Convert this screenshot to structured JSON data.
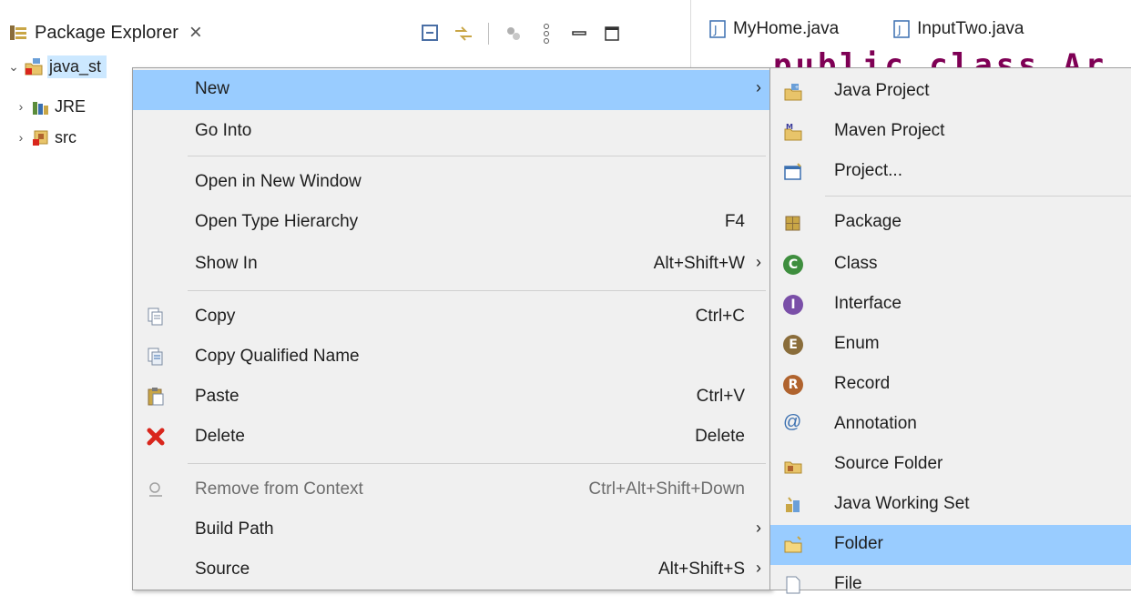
{
  "package_explorer": {
    "title": "Package Explorer",
    "tree": {
      "root": "java_st",
      "children": [
        "JRE",
        "src"
      ]
    }
  },
  "editor": {
    "tabs": [
      "MyHome.java",
      "InputTwo.java"
    ],
    "code_peek": "public class Ar"
  },
  "context_menu": {
    "items": [
      {
        "label": "New",
        "accel": "",
        "submenu": true,
        "highlighted": true,
        "icon": ""
      },
      {
        "label": "Go Into",
        "accel": "",
        "submenu": false,
        "icon": ""
      },
      {
        "label": "Open in New Window",
        "accel": "",
        "submenu": false,
        "icon": ""
      },
      {
        "label": "Open Type Hierarchy",
        "accel": "F4",
        "submenu": false,
        "icon": ""
      },
      {
        "label": "Show In",
        "accel": "Alt+Shift+W",
        "submenu": true,
        "icon": ""
      },
      {
        "label": "Copy",
        "accel": "Ctrl+C",
        "submenu": false,
        "icon": "copy-icon"
      },
      {
        "label": "Copy Qualified Name",
        "accel": "",
        "submenu": false,
        "icon": "copy-qualified-name-icon"
      },
      {
        "label": "Paste",
        "accel": "Ctrl+V",
        "submenu": false,
        "icon": "paste-icon"
      },
      {
        "label": "Delete",
        "accel": "Delete",
        "submenu": false,
        "icon": "delete-icon"
      },
      {
        "label": "Remove from Context",
        "accel": "Ctrl+Alt+Shift+Down",
        "submenu": false,
        "disabled": true,
        "icon": "remove-from-context-icon"
      },
      {
        "label": "Build Path",
        "accel": "",
        "submenu": true,
        "icon": ""
      },
      {
        "label": "Source",
        "accel": "Alt+Shift+S",
        "submenu": true,
        "icon": ""
      }
    ]
  },
  "submenu_new": {
    "items": [
      {
        "label": "Java Project",
        "icon": "java-project-icon"
      },
      {
        "label": "Maven Project",
        "icon": "maven-project-icon"
      },
      {
        "label": "Project...",
        "icon": "project-icon"
      },
      {
        "label": "Package",
        "icon": "package-icon"
      },
      {
        "label": "Class",
        "icon": "class-icon"
      },
      {
        "label": "Interface",
        "icon": "interface-icon"
      },
      {
        "label": "Enum",
        "icon": "enum-icon"
      },
      {
        "label": "Record",
        "icon": "record-icon"
      },
      {
        "label": "Annotation",
        "icon": "annotation-icon"
      },
      {
        "label": "Source Folder",
        "icon": "source-folder-icon"
      },
      {
        "label": "Java Working Set",
        "icon": "java-working-set-icon"
      },
      {
        "label": "Folder",
        "icon": "folder-icon",
        "highlighted": true
      },
      {
        "label": "File",
        "icon": "file-icon"
      }
    ]
  },
  "colors": {
    "menu_bg": "#f0f0f0",
    "highlight": "#99ccff",
    "selection": "#cce8ff",
    "keyword": "#7f0055"
  }
}
